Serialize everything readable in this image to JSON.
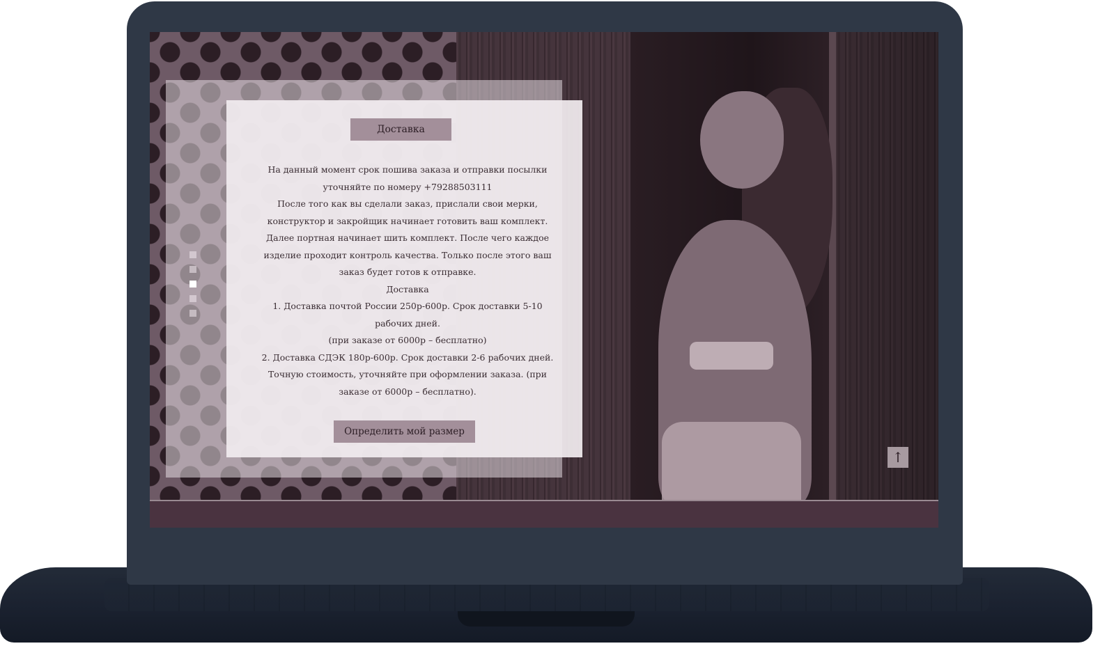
{
  "panel": {
    "title": "Доставка",
    "paragraphs": [
      "На данный момент срок пошива заказа и отправки посылки уточняйте по номеру +79288503111",
      "После того как вы сделали заказ, прислали свои мерки, конструктор и закройщик начинает готовить ваш комплект. Далее портная начинает шить комплект. После чего каждое изделие проходит контроль качества. Только после этого ваш заказ будет готов к отправке.",
      "Доставка",
      "1. Доставка почтой России 250р-600р. Срок доставки 5-10 рабочих дней.",
      "(при заказе от 6000р – бесплатно)",
      "2. Доставка СДЭК 180р-600р. Срок доставки 2-6 рабочих дней. Точную стоимость, уточняйте  при оформлении заказа. (при заказе от  6000р – бесплатно)."
    ],
    "button_label": "Определить мой размер"
  },
  "slider": {
    "dot_count": 5,
    "active_index": 2
  },
  "scroll_top": {
    "icon": "arrow-up-icon",
    "glyph": "↑"
  },
  "colors": {
    "accent": "#a38f9a",
    "panel_bg": "#f1ecef",
    "footer": "#4a3340",
    "device": "#2f3846"
  }
}
